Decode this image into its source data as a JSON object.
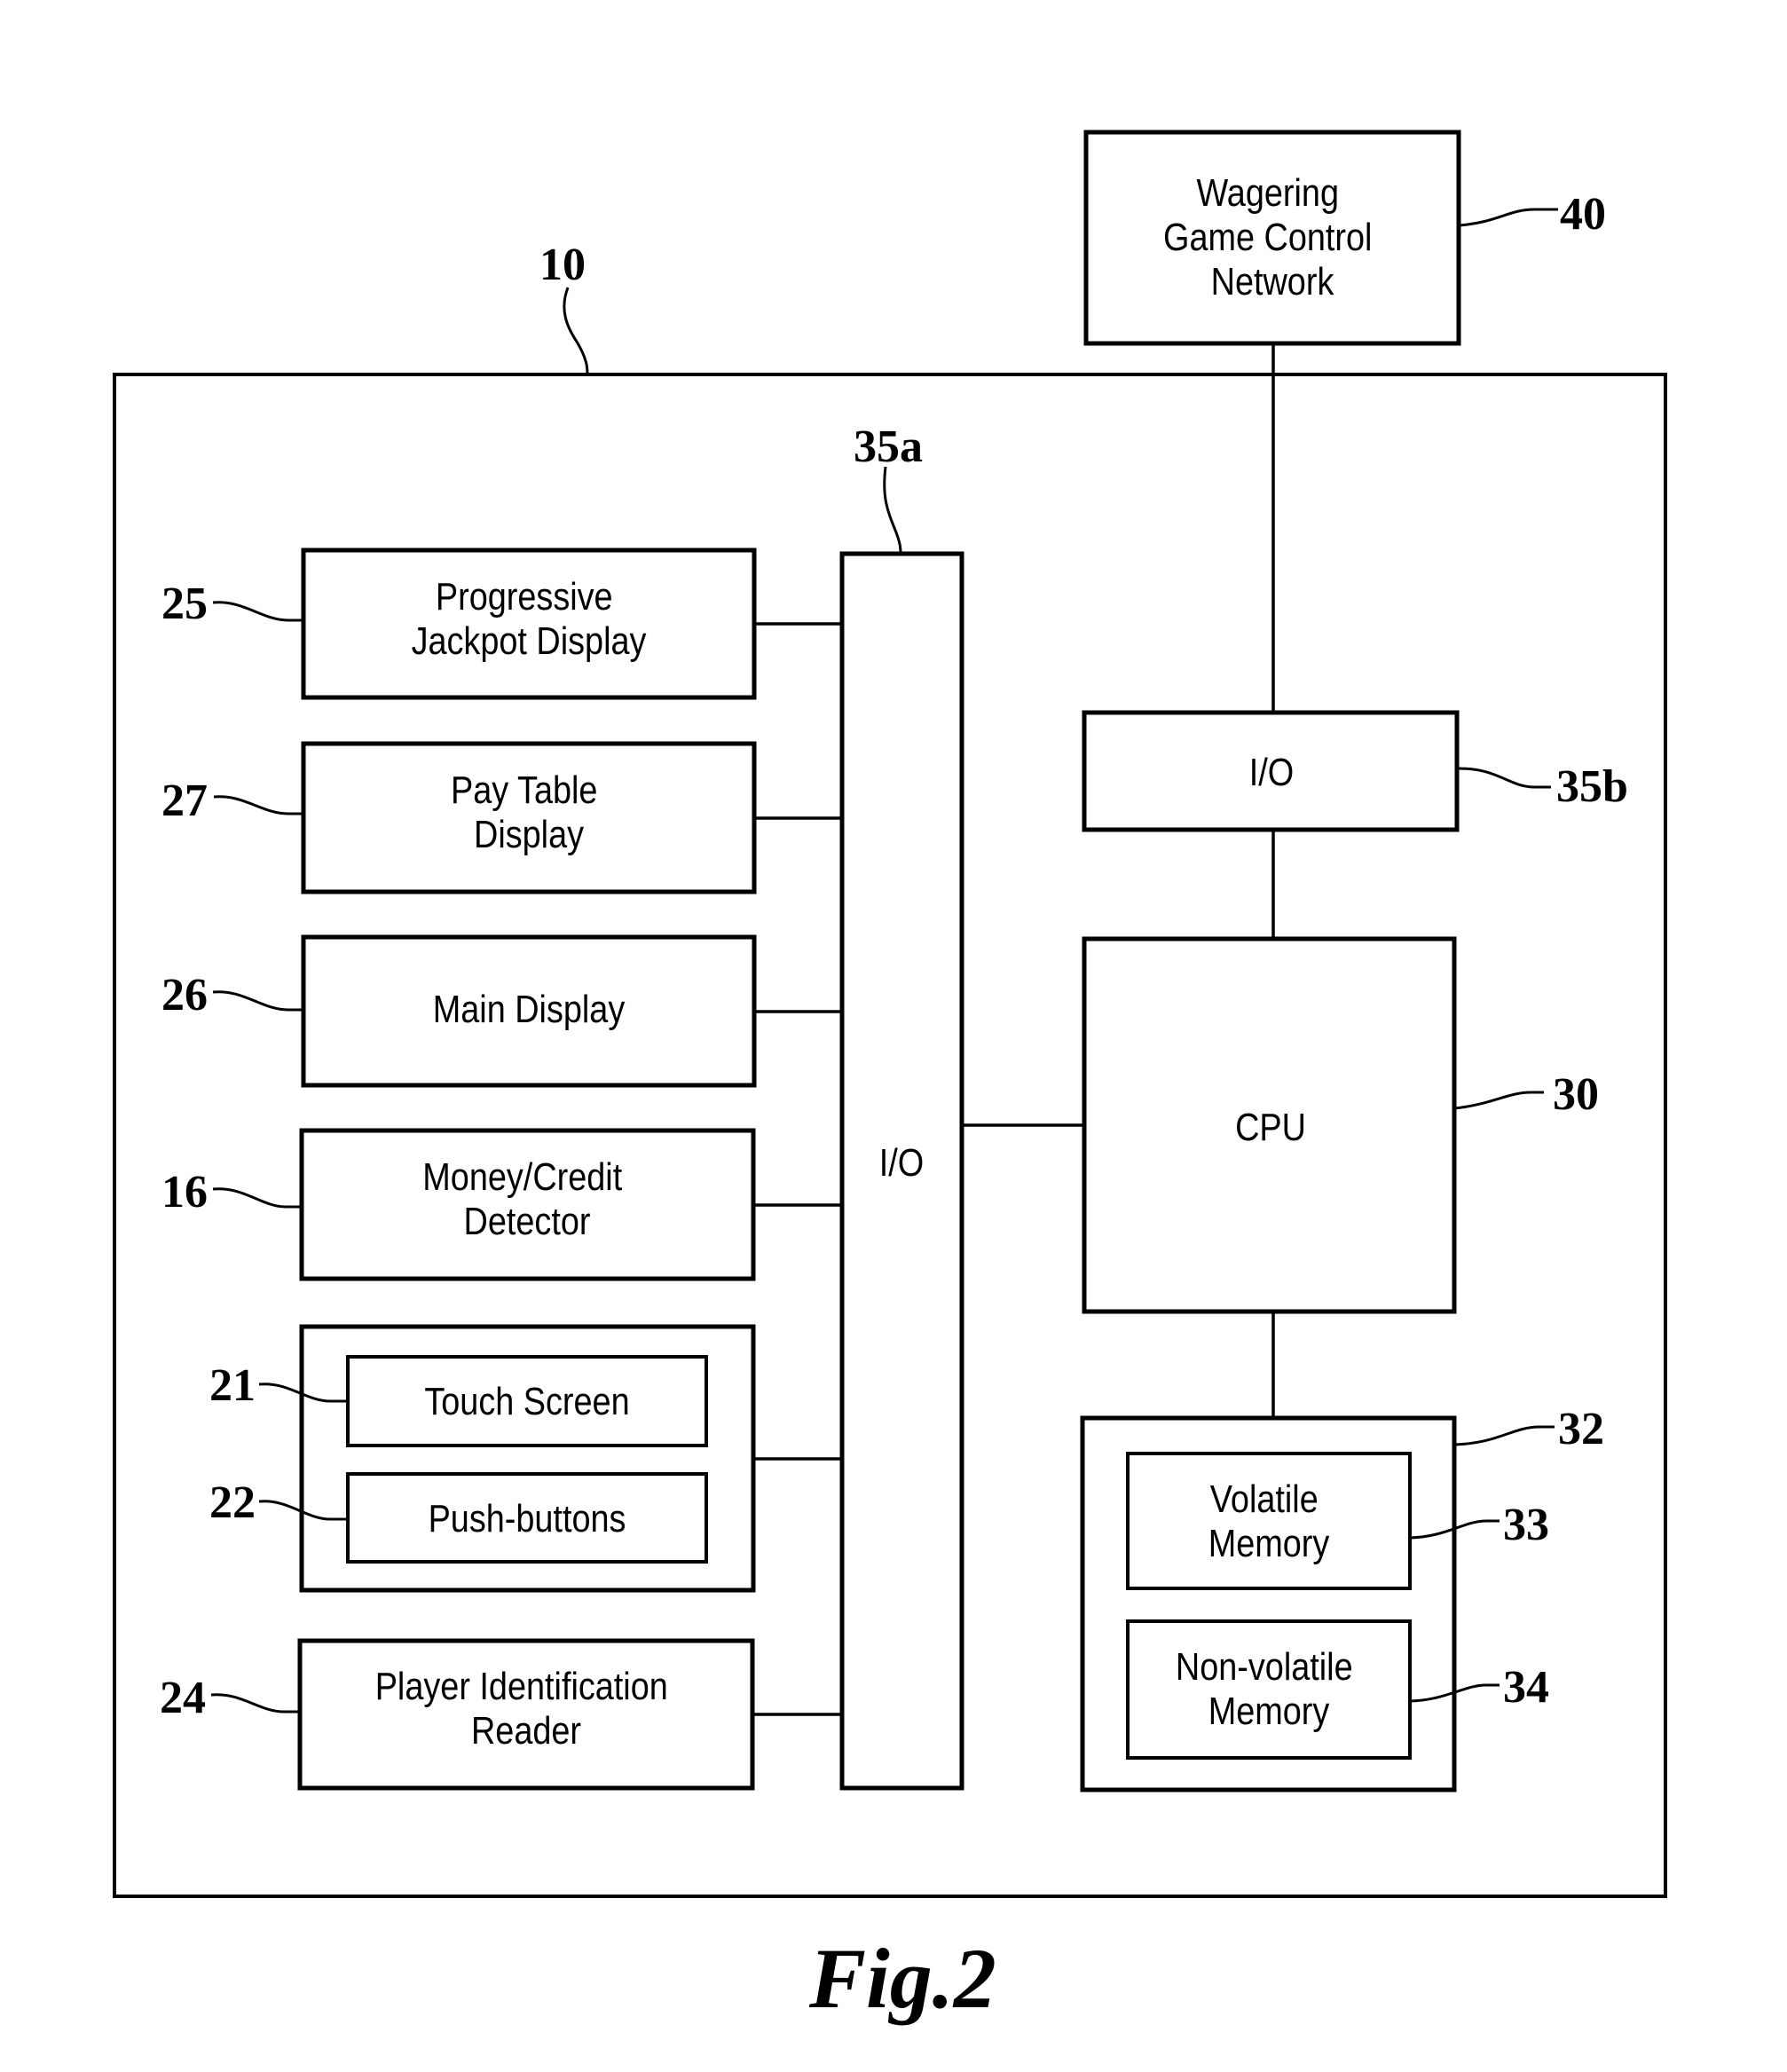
{
  "figure": {
    "caption": "Fig.2",
    "device_ref": "10"
  },
  "blocks": {
    "network": {
      "ref": "40",
      "lines": [
        "Wagering",
        "Game Control",
        "Network"
      ]
    },
    "io_bus": {
      "ref": "35a",
      "label": "I/O"
    },
    "io_net": {
      "ref": "35b",
      "label": "I/O"
    },
    "cpu": {
      "ref": "30",
      "label": "CPU"
    },
    "memory": {
      "ref": "32"
    },
    "volatile": {
      "ref": "33",
      "lines": [
        "Volatile",
        "Memory"
      ]
    },
    "nonvolatile": {
      "ref": "34",
      "lines": [
        "Non-volatile",
        "Memory"
      ]
    },
    "jackpot": {
      "ref": "25",
      "lines": [
        "Progressive",
        "Jackpot Display"
      ]
    },
    "paytable": {
      "ref": "27",
      "lines": [
        "Pay Table",
        "Display"
      ]
    },
    "main_display": {
      "ref": "26",
      "lines": [
        "Main Display"
      ]
    },
    "money": {
      "ref": "16",
      "lines": [
        "Money/Credit",
        "Detector"
      ]
    },
    "touch": {
      "ref": "21",
      "lines": [
        "Touch Screen"
      ]
    },
    "pushbuttons": {
      "ref": "22",
      "lines": [
        "Push-buttons"
      ]
    },
    "player_id": {
      "ref": "24",
      "lines": [
        "Player Identification",
        "Reader"
      ]
    }
  }
}
